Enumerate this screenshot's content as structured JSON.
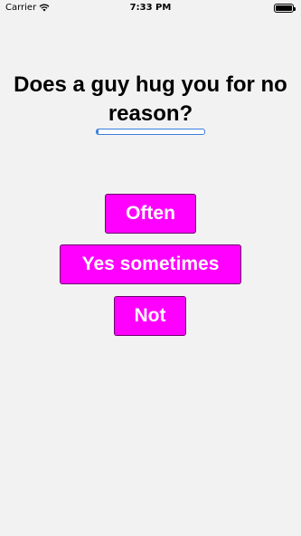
{
  "status_bar": {
    "carrier": "Carrier",
    "time": "7:33 PM",
    "wifi_icon": "wifi-icon",
    "battery_icon": "battery-icon"
  },
  "quiz": {
    "question": "Does a guy hug you for no reason?",
    "progress": 0.02,
    "answers": [
      "Often",
      "Yes sometimes",
      "Not"
    ]
  },
  "colors": {
    "background": "#f2f2f2",
    "answer_button": "#ff00ff",
    "answer_text": "#ffffff",
    "progress": "#3b7de0"
  }
}
